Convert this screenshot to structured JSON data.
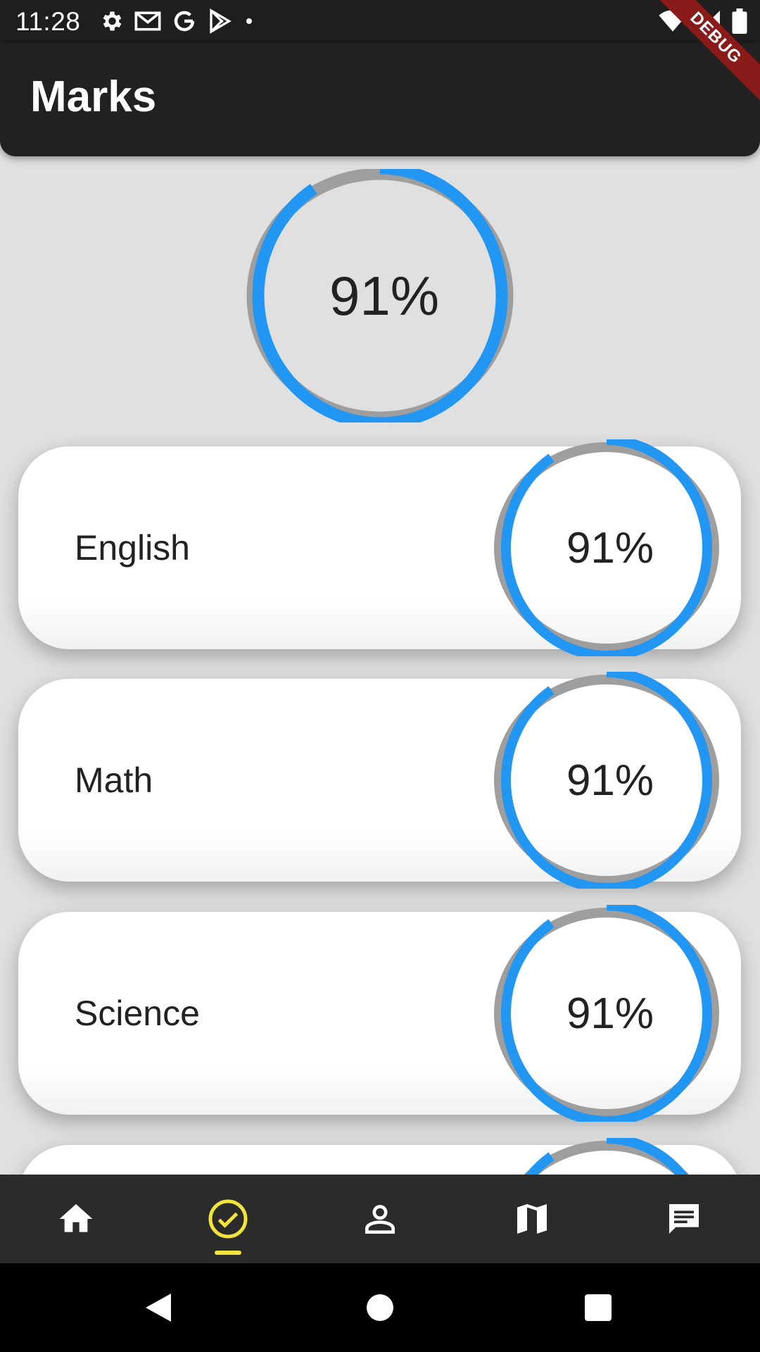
{
  "status_bar": {
    "time": "11:28",
    "left_icons": [
      "settings-icon",
      "gmail-icon",
      "google-icon",
      "play-store-icon",
      "dot-icon"
    ],
    "right_icons": [
      "wifi-icon",
      "signal-icon",
      "battery-icon"
    ],
    "debug_label": "DEBUG"
  },
  "app_bar": {
    "title": "Marks"
  },
  "overall": {
    "label": "91%",
    "progress": 0.91
  },
  "subjects": [
    {
      "name": "English",
      "label": "91%",
      "progress": 0.91
    },
    {
      "name": "Math",
      "label": "91%",
      "progress": 0.91
    },
    {
      "name": "Science",
      "label": "91%",
      "progress": 0.91
    },
    {
      "name": "",
      "label": "",
      "progress": 0.91
    }
  ],
  "bottom_nav": {
    "items": [
      "home-icon",
      "check-circle-icon",
      "person-icon",
      "map-icon",
      "chat-icon"
    ],
    "selected_index": 1,
    "colors": {
      "selected": "#f2e43a",
      "default": "#ffffff"
    }
  },
  "colors": {
    "ring_progress": "#2196f3",
    "ring_track": "#9e9e9e",
    "app_bar": "#212121",
    "background": "#e0e0e0"
  }
}
